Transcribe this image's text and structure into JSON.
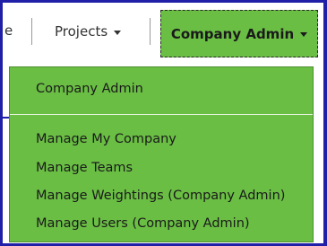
{
  "navbar": {
    "truncated_item": "e",
    "projects_label": "Projects",
    "company_admin_label": "Company Admin"
  },
  "menu": {
    "header_item": "Company Admin",
    "items": [
      "Manage My Company",
      "Manage Teams",
      "Manage Weightings (Company Admin)",
      "Manage Users (Company Admin)"
    ]
  },
  "colors": {
    "accent_green": "#6abe44",
    "frame_blue": "#1f1fa8",
    "text_dark": "#1a1a1a"
  }
}
